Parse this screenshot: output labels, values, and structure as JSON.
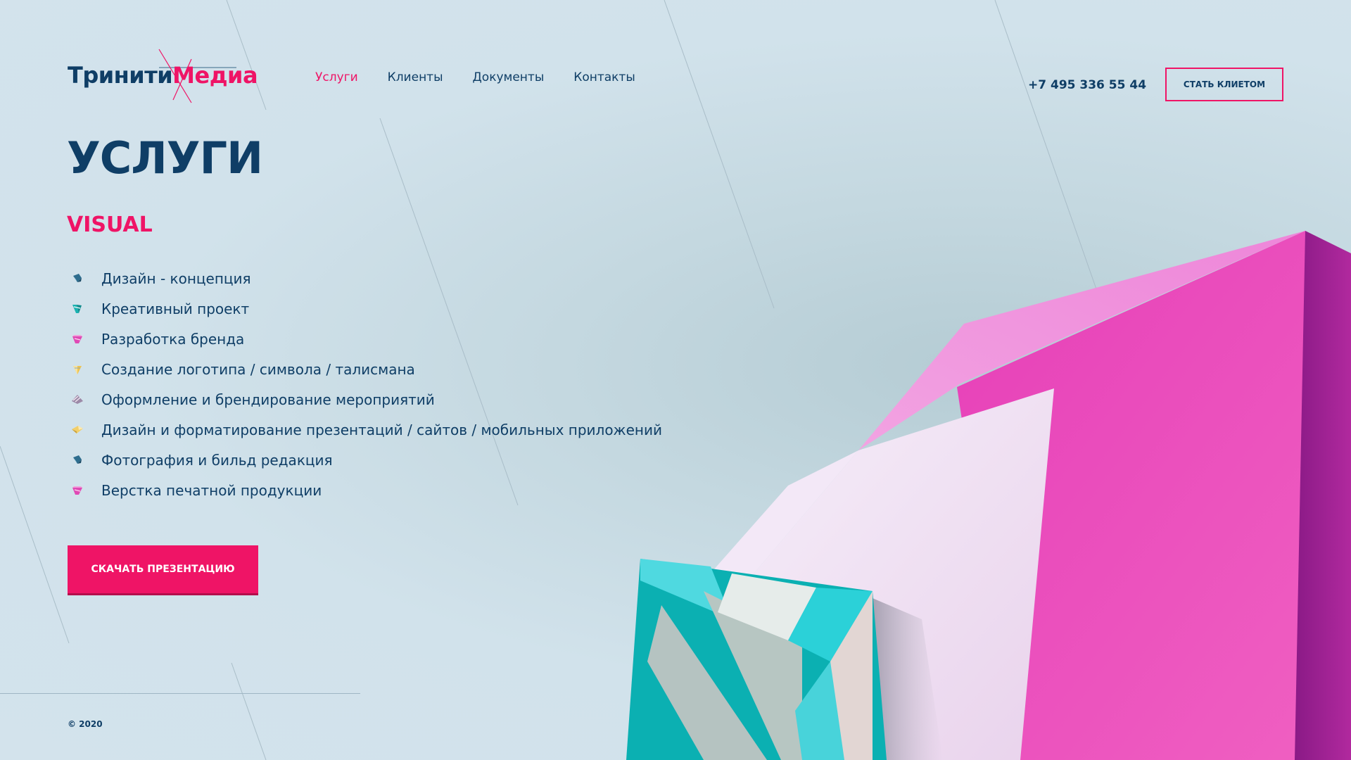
{
  "brand": {
    "part1": "Тринити",
    "part2": "Медиа"
  },
  "nav": [
    {
      "label": "Услуги",
      "active": true
    },
    {
      "label": "Клиенты",
      "active": false
    },
    {
      "label": "Документы",
      "active": false
    },
    {
      "label": "Контакты",
      "active": false
    }
  ],
  "header": {
    "phone": "+7 495 336 55 44",
    "cta_label": "СТАТЬ КЛИЕТОМ"
  },
  "page": {
    "title": "УСЛУГИ",
    "subtitle": "VISUAL"
  },
  "services": [
    {
      "label": "Дизайн - концепция",
      "icon": "blue-gem-icon"
    },
    {
      "label": "Креативный проект",
      "icon": "teal-gem-icon"
    },
    {
      "label": "Разработка бренда",
      "icon": "pink-gem-icon"
    },
    {
      "label": "Создание логотипа / символа / талисмана",
      "icon": "gold-gem-icon"
    },
    {
      "label": "Оформление и брендирование мероприятий",
      "icon": "striped-gem-icon"
    },
    {
      "label": "Дизайн и форматирование презентаций / сайтов / мобильных приложений",
      "icon": "yellow-gem-icon"
    },
    {
      "label": "Фотография и бильд редакция",
      "icon": "blue-gem-icon"
    },
    {
      "label": "Верстка печатной продукции",
      "icon": "pink-gem-icon"
    }
  ],
  "download_label": "СКАЧАТЬ ПРЕЗЕНТАЦИЮ",
  "footer": {
    "copyright": "© 2020"
  },
  "colors": {
    "accent": "#ef1466",
    "primary": "#0f3e66",
    "background": "#cfe0ea"
  }
}
